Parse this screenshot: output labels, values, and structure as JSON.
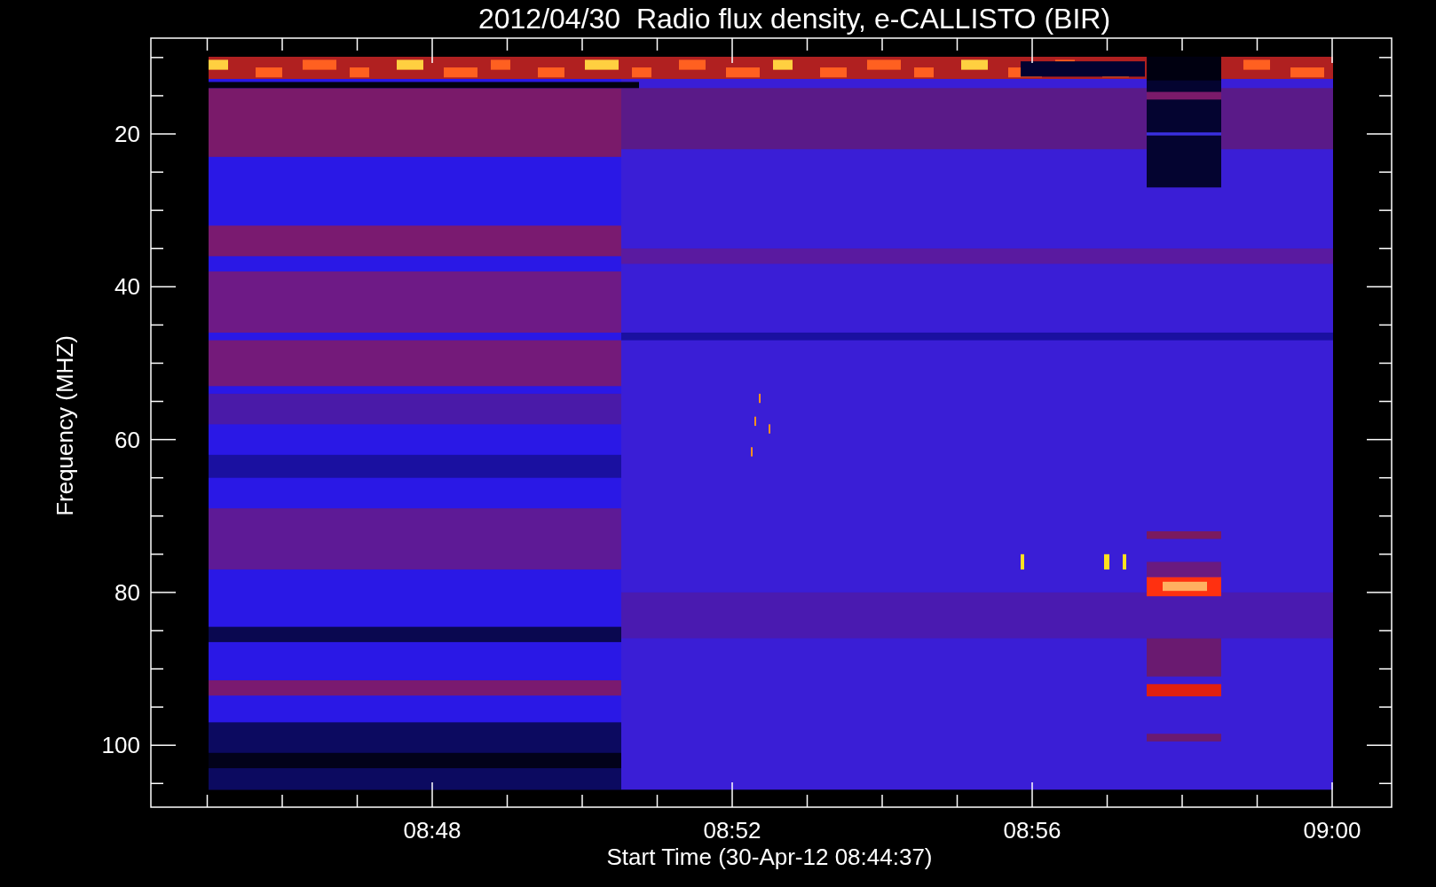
{
  "title": "2012/04/30  Radio flux density, e-CALLISTO (BIR)",
  "y_axis": {
    "label": "Frequency (MHZ)",
    "ticks": [
      "20",
      "40",
      "60",
      "80",
      "100"
    ]
  },
  "x_axis": {
    "label": "Start Time (30-Apr-12 08:44:37)",
    "ticks": [
      "08:48",
      "08:52",
      "08:56",
      "09:00"
    ]
  }
}
